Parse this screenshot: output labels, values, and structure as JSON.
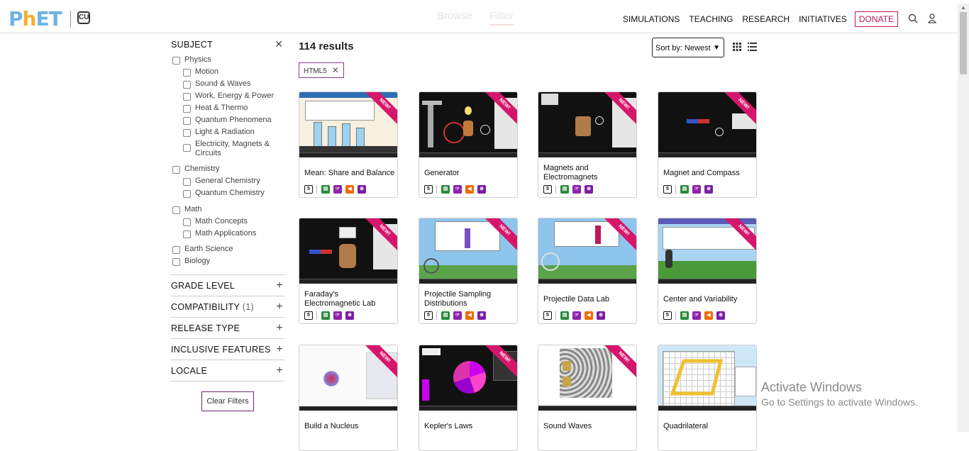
{
  "header": {
    "logo_text": "PhET",
    "center_tabs": [
      "Browse",
      "Filter"
    ],
    "nav": [
      "SIMULATIONS",
      "TEACHING",
      "RESEARCH",
      "INITIATIVES"
    ],
    "donate": "DONATE"
  },
  "sidebar": {
    "subject_title": "SUBJECT",
    "physics": "Physics",
    "physics_items": [
      "Motion",
      "Sound & Waves",
      "Work, Energy & Power",
      "Heat & Thermo",
      "Quantum Phenomena",
      "Light & Radiation",
      "Electricity, Magnets & Circuits"
    ],
    "chemistry": "Chemistry",
    "chemistry_items": [
      "General Chemistry",
      "Quantum Chemistry"
    ],
    "math": "Math",
    "math_items": [
      "Math Concepts",
      "Math Applications"
    ],
    "earth_science": "Earth Science",
    "biology": "Biology",
    "sections": {
      "grade_level": "GRADE LEVEL",
      "compatibility": "COMPATIBILITY",
      "compatibility_count": "(1)",
      "release_type": "RELEASE TYPE",
      "inclusive_features": "INCLUSIVE FEATURES",
      "locale": "LOCALE"
    },
    "clear_filters": "Clear Filters"
  },
  "results": {
    "count": "114 results",
    "chip": "HTML5",
    "sort_label": "Sort by:",
    "sort_value": "Newest"
  },
  "cards": [
    {
      "title": "Mean: Share and Balance",
      "ribbon": "NEW!"
    },
    {
      "title": "Generator",
      "ribbon": "NEW!"
    },
    {
      "title": "Magnets and Electromagnets",
      "ribbon": "NEW!"
    },
    {
      "title": "Magnet and Compass",
      "ribbon": "NEW!"
    },
    {
      "title": "Faraday's Electromagnetic Lab",
      "ribbon": "NEW!"
    },
    {
      "title": "Projectile Sampling Distributions",
      "ribbon": "NEW!"
    },
    {
      "title": "Projectile Data Lab",
      "ribbon": "NEW!"
    },
    {
      "title": "Center and Variability",
      "ribbon": "NEW!"
    },
    {
      "title": "Build a Nucleus",
      "ribbon": "NEW!"
    },
    {
      "title": "Kepler's Laws",
      "ribbon": "NEW!"
    },
    {
      "title": "Sound Waves",
      "ribbon": "NEW!"
    },
    {
      "title": "Quadrilateral",
      "ribbon": ""
    }
  ],
  "watermark": {
    "line1": "Activate Windows",
    "line2": "Go to Settings to activate Windows."
  }
}
